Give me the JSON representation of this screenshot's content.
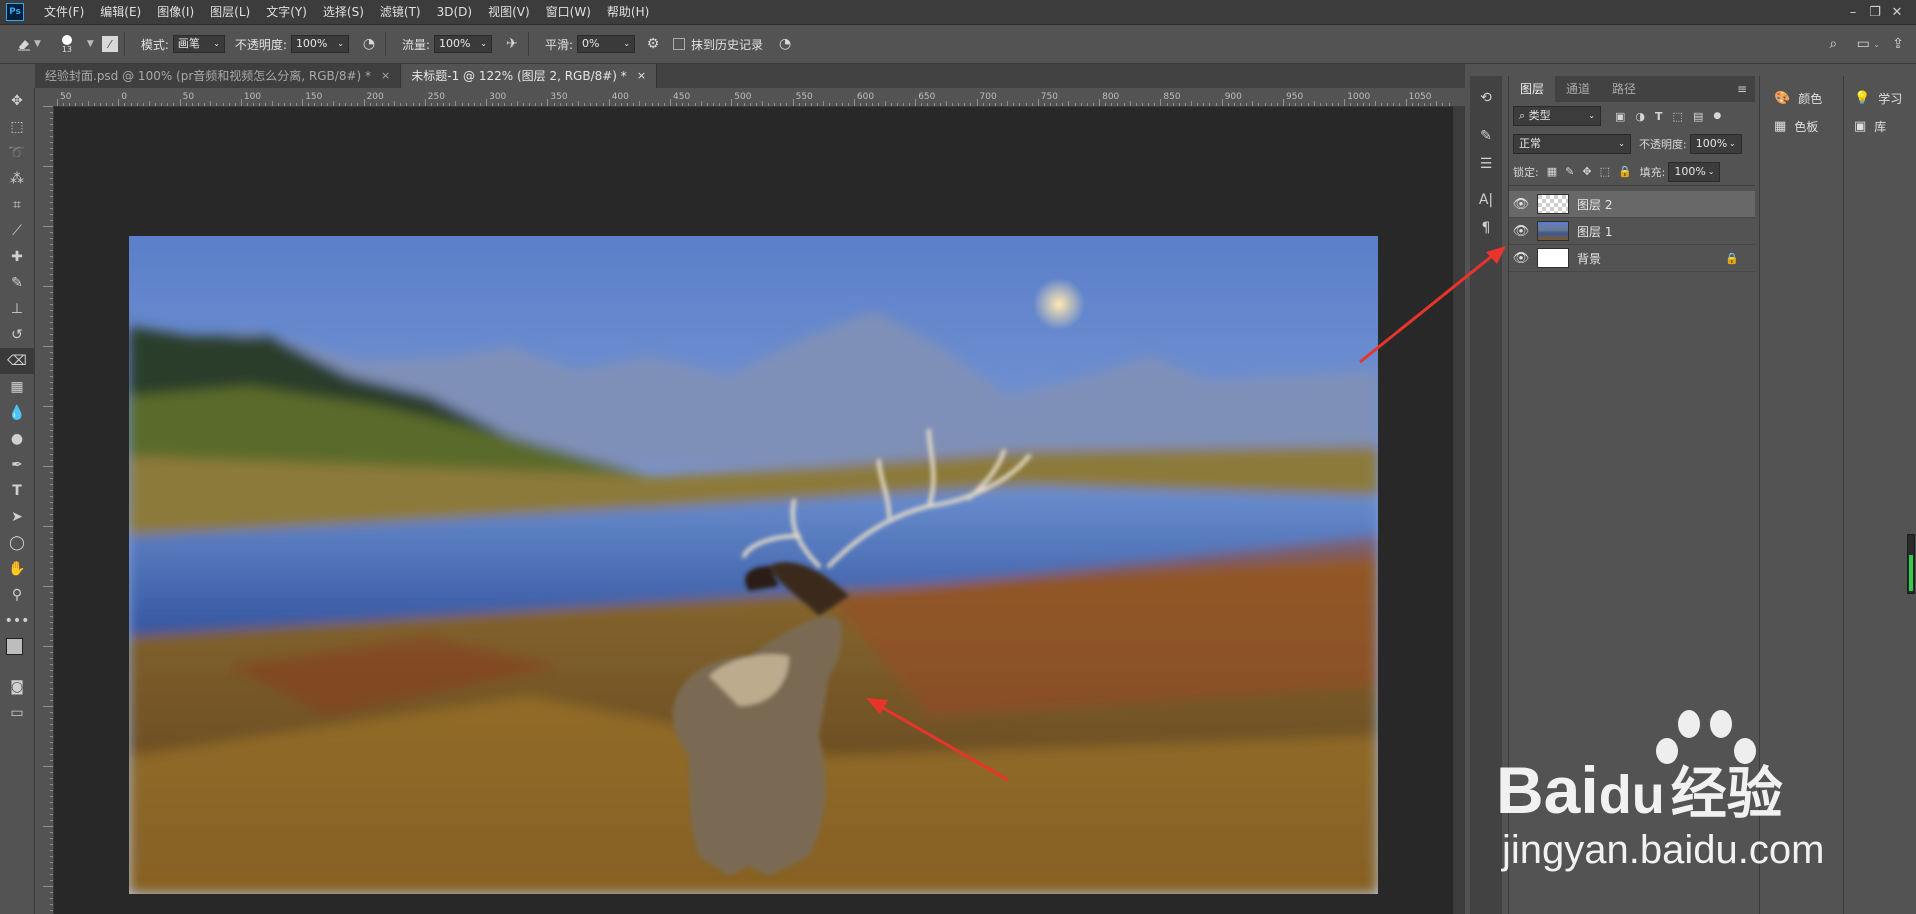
{
  "app": {
    "logo": "Ps"
  },
  "menubar": {
    "items": [
      "文件(F)",
      "编辑(E)",
      "图像(I)",
      "图层(L)",
      "文字(Y)",
      "选择(S)",
      "滤镜(T)",
      "3D(D)",
      "视图(V)",
      "窗口(W)",
      "帮助(H)"
    ],
    "window_icons": [
      "minimize-icon",
      "restore-icon",
      "close-icon"
    ]
  },
  "options": {
    "brush_size": "13",
    "mode_label": "模式:",
    "mode_value": "画笔",
    "opacity_label": "不透明度:",
    "opacity_value": "100%",
    "flow_label": "流量:",
    "flow_value": "100%",
    "smooth_label": "平滑:",
    "smooth_value": "0%",
    "history_label": "抹到历史记录"
  },
  "tabs": [
    {
      "label": "经验封面.psd @ 100% (pr音频和视频怎么分离, RGB/8#) *",
      "close": "×"
    },
    {
      "label": "未标题-1 @ 122% (图层 2, RGB/8#) *",
      "close": "×"
    }
  ],
  "ruler": {
    "numbers": [
      "50",
      "0",
      "50",
      "100",
      "150",
      "200",
      "250",
      "300",
      "350",
      "400",
      "450",
      "500",
      "550",
      "600",
      "650",
      "700",
      "750",
      "800",
      "850",
      "900",
      "950",
      "1000",
      "1050"
    ]
  },
  "layers_panel": {
    "tabs": [
      "图层",
      "通道",
      "路径"
    ],
    "filter_kind": "类型",
    "blend_mode": "正常",
    "opacity_label": "不透明度:",
    "opacity_value": "100%",
    "lock_label": "锁定:",
    "fill_label": "填充:",
    "fill_value": "100%",
    "layers": [
      {
        "name": "图层 2",
        "selected": true
      },
      {
        "name": "图层 1",
        "selected": false
      },
      {
        "name": "背景",
        "selected": false,
        "locked": true
      }
    ]
  },
  "side_panels": {
    "color": "颜色",
    "swatches": "色板",
    "learn": "学习",
    "library": "库"
  },
  "watermark": {
    "brand_latin": "Bai",
    "brand_du": "du",
    "brand_cn": "经验",
    "url": "jingyan.baidu.com"
  },
  "colors": {
    "accent_arrow": "#e8342a",
    "ps_blue": "#31a8ff"
  }
}
